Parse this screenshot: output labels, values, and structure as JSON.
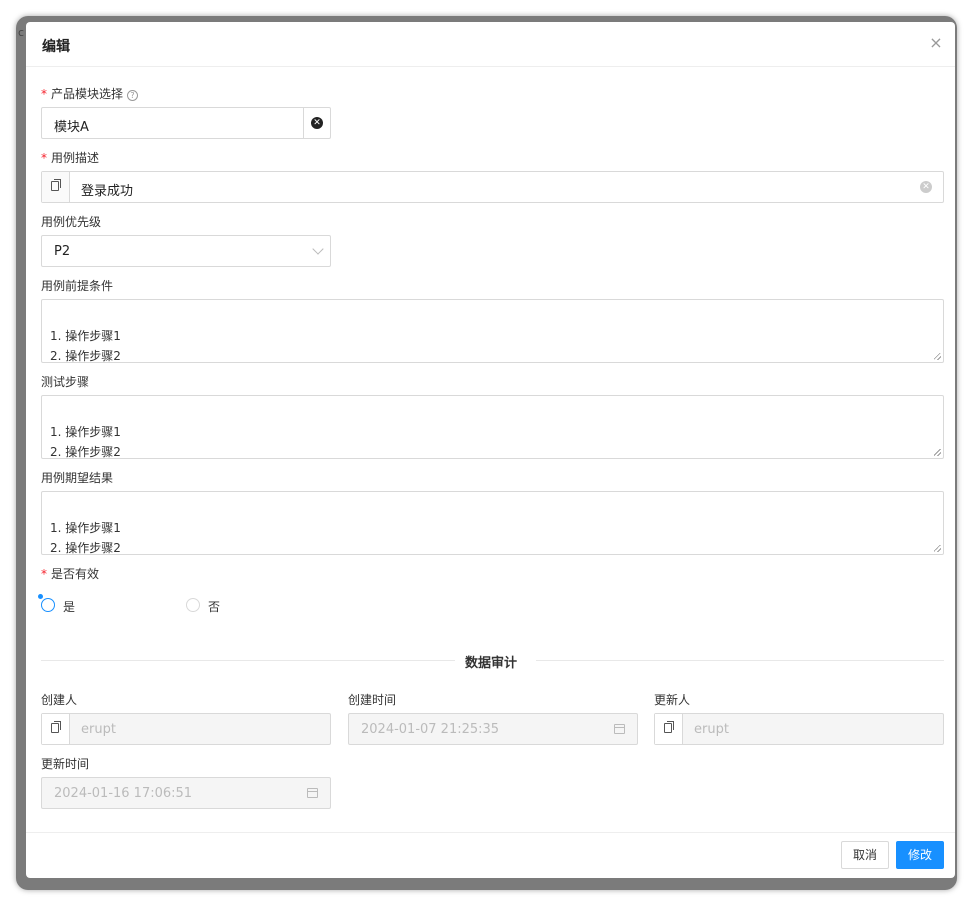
{
  "background": {
    "fragment": "c"
  },
  "modal": {
    "title": "编辑",
    "close_glyph": "×"
  },
  "form": {
    "module": {
      "label": "产品模块选择",
      "required": "*",
      "help": "?",
      "value": "模块A",
      "clear": "✕"
    },
    "case_desc": {
      "label": "用例描述",
      "required": "*",
      "value": "登录成功",
      "clear": "✕"
    },
    "priority": {
      "label": "用例优先级",
      "value": "P2"
    },
    "precondition": {
      "label": "用例前提条件",
      "value": "1. 操作步骤1\n2. 操作步骤2"
    },
    "steps": {
      "label": "测试步骤",
      "value": "1. 操作步骤1\n2. 操作步骤2"
    },
    "expected": {
      "label": "用例期望结果",
      "value": "1. 操作步骤1\n2. 操作步骤2"
    },
    "valid": {
      "label": "是否有效",
      "required": "*",
      "options": [
        "是",
        "否"
      ],
      "selected": "是"
    }
  },
  "audit": {
    "section_title": "数据审计",
    "creator": {
      "label": "创建人",
      "value": "erupt"
    },
    "create_time": {
      "label": "创建时间",
      "value": "2024-01-07 21:25:35"
    },
    "updater": {
      "label": "更新人",
      "value": "erupt"
    },
    "update_time": {
      "label": "更新时间",
      "value": "2024-01-16 17:06:51"
    }
  },
  "footer": {
    "cancel_label": "取消",
    "submit_label": "修改"
  },
  "colors": {
    "accent": "#1890ff",
    "required": "#f5222d",
    "clear_dark": "#222222",
    "clear_light": "#cccccc"
  },
  "icons": [
    "help-icon",
    "clear-icon",
    "copy-icon",
    "chevron-down-icon",
    "calendar-icon",
    "close-icon",
    "resize-grip-icon"
  ]
}
